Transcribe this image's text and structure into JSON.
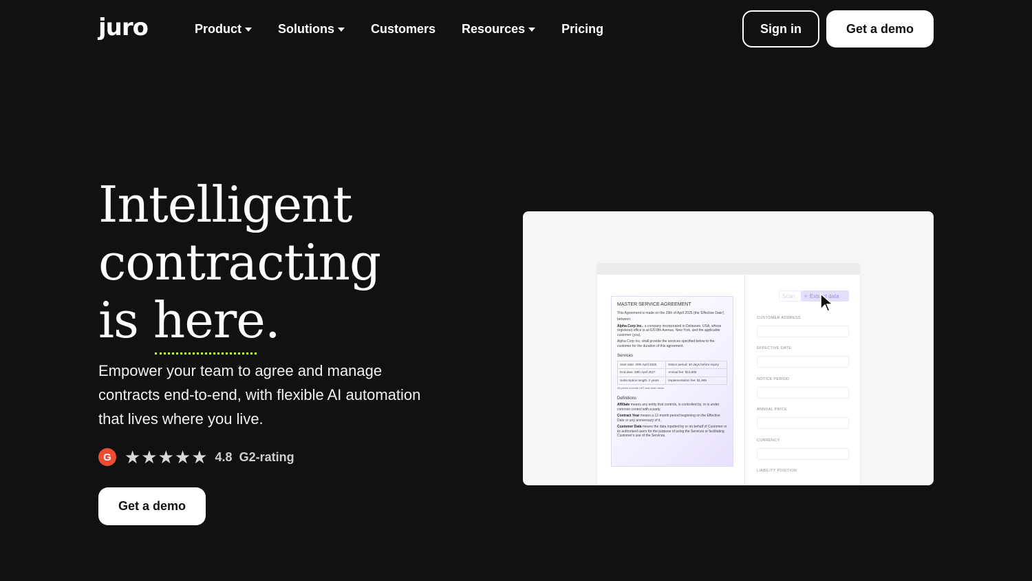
{
  "nav": {
    "logo": "juro",
    "items": [
      {
        "label": "Product",
        "dropdown": true
      },
      {
        "label": "Solutions",
        "dropdown": true
      },
      {
        "label": "Customers",
        "dropdown": false
      },
      {
        "label": "Resources",
        "dropdown": true
      },
      {
        "label": "Pricing",
        "dropdown": false
      }
    ],
    "sign_in": "Sign in",
    "get_demo": "Get a demo"
  },
  "hero": {
    "title_line1": "Intelligent",
    "title_line2": "contracting",
    "title_line3_prefix": "is ",
    "title_line3_highlight": "here",
    "title_line3_suffix": ".",
    "subtitle": "Empower your team to agree and manage contracts end-to-end, with flexible AI automation that lives where you live.",
    "rating": {
      "badge": "G",
      "stars": "★★★★★",
      "value": "4.8",
      "label": "G2-rating"
    },
    "cta": "Get a demo"
  },
  "preview": {
    "doc": {
      "title": "MASTER SERVICE AGREEMENT",
      "intro": "This Agreement is made on the 29th of April 2025 (the 'Effective Date')",
      "between": "between:",
      "party_name": "Alpha Corp Inc.",
      "party_text": ", a company incorporated in Delaware, USA, whose registered office is at 620 8th Avenue, New York, and the applicable customer (you).",
      "party_services": "Alpha Corp Inc. shall provide the services specified below to the customer for the duration of this agreement.",
      "services_heading": "Services",
      "table": [
        [
          "Start date: 29th April 2025",
          "Notice period: 30 days before expiry"
        ],
        [
          "End date: 28th April 2027",
          "Annual fee: $13,800"
        ],
        [
          "Subscription length: 2 years",
          "Implementation fee: $1,999"
        ]
      ],
      "table_note": "All prices exclude VAT and other taxes",
      "definitions_heading": "Definitions",
      "def1_term": "Affiliate",
      "def1_text": " means any entity that controls, is controlled by, or is under common control with a party.",
      "def2_term": "Contract Year",
      "def2_text": " means a 12-month period beginning on the Effective Date or any anniversary of it.",
      "def3_term": "Customer Data",
      "def3_text": " means the data inputted by or on behalf of Customer or its authorised users for the purpose of using the Services or facilitating Customer's use of the Services."
    },
    "panel": {
      "scan_label": "Scan",
      "extract_label": "Extract data",
      "fields": [
        "CUSTOMER ADDRESS",
        "EFFECTIVE DATE",
        "NOTICE PERIOD",
        "ANNUAL PRICE",
        "CURRENCY",
        "LIABILITY POSITION"
      ]
    }
  }
}
